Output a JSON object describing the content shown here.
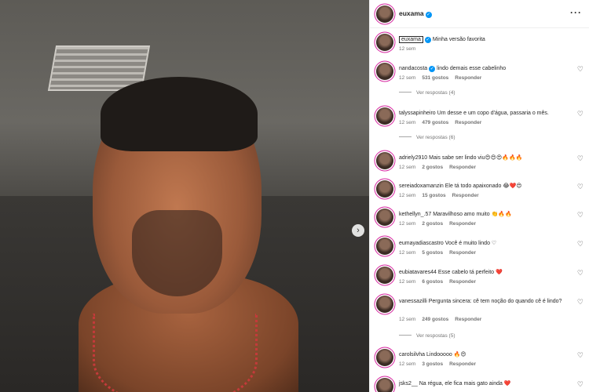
{
  "header": {
    "username": "euxama",
    "more_icon": "more-horizontal-icon"
  },
  "photo": {
    "next_icon": "chevron-right-icon"
  },
  "caption": {
    "username": "euxama",
    "text": "Minha versão favorita",
    "time": "12 sem"
  },
  "comments": [
    {
      "user": "nandacosta",
      "verified": true,
      "text": "lindo demais esse cabelinho",
      "time": "12 sem",
      "likes": "531 gostos",
      "reply": "Responder",
      "replies": "Ver respostas (4)"
    },
    {
      "user": "talyssapinheiro",
      "verified": false,
      "text": "Um desse e um copo d'água, passaria o mês.",
      "time": "12 sem",
      "likes": "479 gostos",
      "reply": "Responder",
      "replies": "Ver respostas (6)"
    },
    {
      "user": "adriely2910",
      "verified": false,
      "text": "Mais sabe ser lindo viu😍😍😍🔥🔥🔥",
      "time": "12 sem",
      "likes": "2 gostos",
      "reply": "Responder",
      "replies": ""
    },
    {
      "user": "sereiadoxamanzin",
      "verified": false,
      "text": "Ele tá todo apaixonado 😂❤️😍",
      "time": "12 sem",
      "likes": "15 gostos",
      "reply": "Responder",
      "replies": ""
    },
    {
      "user": "kethellyn_.57",
      "verified": false,
      "text": "Maravilhoso amo muito 👏🔥🔥",
      "time": "12 sem",
      "likes": "2 gostos",
      "reply": "Responder",
      "replies": ""
    },
    {
      "user": "eumayadiascastro",
      "verified": false,
      "text": "Você é muito lindo ♡",
      "time": "12 sem",
      "likes": "5 gostos",
      "reply": "Responder",
      "replies": ""
    },
    {
      "user": "eubiatavares44",
      "verified": false,
      "text": "Esse cabelo tá perfeito ❤️",
      "time": "12 sem",
      "likes": "6 gostos",
      "reply": "Responder",
      "replies": ""
    },
    {
      "user": "vanessazilli",
      "verified": false,
      "text": "Pergunta sincera: cê tem noção do quando cê é lindo?",
      "time": "12 sem",
      "likes": "249 gostos",
      "reply": "Responder",
      "replies": "Ver respostas (5)"
    },
    {
      "user": "carolsilvha",
      "verified": false,
      "text": "Lindooooo 🔥😍",
      "time": "12 sem",
      "likes": "3 gostos",
      "reply": "Responder",
      "replies": ""
    },
    {
      "user": "jsks2__",
      "verified": false,
      "text": "Na régua, ele fica mais gato ainda ❤️",
      "time": "",
      "likes": "",
      "reply": "",
      "replies": ""
    }
  ],
  "colors": {
    "verified": "#0095f6",
    "story_ring": "#d6249f"
  }
}
